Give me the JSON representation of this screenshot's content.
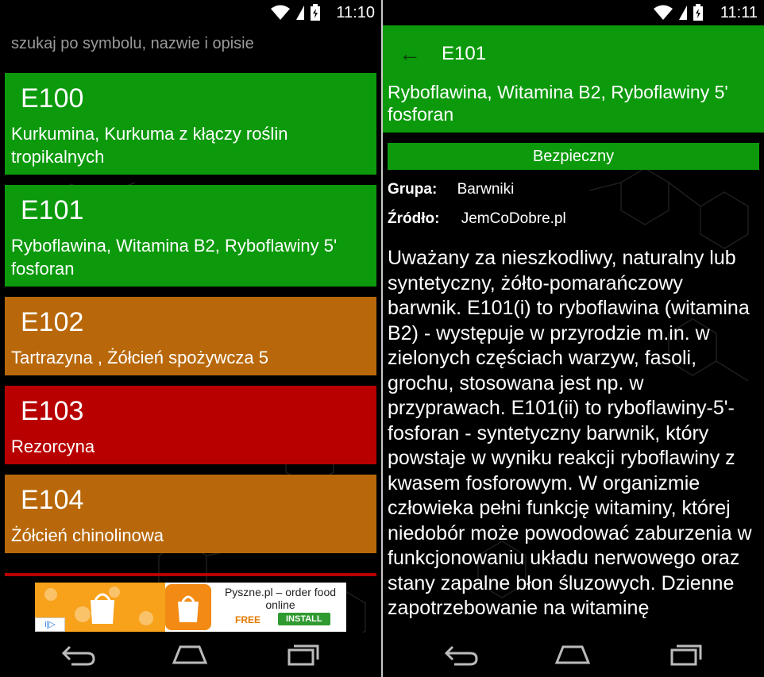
{
  "colors": {
    "green": "#0c9a0c",
    "orange": "#b8680a",
    "red": "#b80000",
    "background": "#000000"
  },
  "left": {
    "status": {
      "time": "11:10"
    },
    "search": {
      "placeholder": "szukaj po symbolu, nazwie i opisie"
    },
    "items": [
      {
        "code": "E100",
        "name": "Kurkumina, Kurkuma z kłączy roślin tropikalnych",
        "status": "green"
      },
      {
        "code": "E101",
        "name": "Ryboflawina, Witamina B2, Ryboflawiny 5' fosforan",
        "status": "green"
      },
      {
        "code": "E102",
        "name": "Tartrazyna , Żółcień spożywcza 5",
        "status": "orange"
      },
      {
        "code": "E103",
        "name": "Rezorcyna",
        "status": "red"
      },
      {
        "code": "E104",
        "name": "Żółcień chinolinowa",
        "status": "orange"
      }
    ],
    "ad": {
      "title": "Pyszne.pl – order food online",
      "price": "FREE",
      "install": "INSTALL",
      "choices_icon": "adchoices-icon"
    }
  },
  "right": {
    "status": {
      "time": "11:11"
    },
    "detail": {
      "code": "E101",
      "name": "Ryboflawina, Witamina B2, Ryboflawiny 5' fosforan",
      "safety": "Bezpieczny",
      "group_label": "Grupa:",
      "group_value": "Barwniki",
      "source_label": "Źródło:",
      "source_value": "JemCoDobre.pl",
      "description": "Uważany za nieszkodliwy, naturalny lub syntetyczny, żółto-pomarańczowy barwnik. E101(i) to ryboflawina (witamina B2) - występuje w przyrodzie m.in. w zielonych częściach warzyw, fasoli, grochu, stosowana jest np. w przyprawach. E101(ii) to ryboflawiny-5'-fosforan - syntetyczny barwnik, który powstaje w wyniku reakcji ryboflawiny z kwasem fosforowym. W organizmie człowieka pełni funkcję witaminy, której niedobór może powodować zaburzenia w funkcjonowaniu układu nerwowego oraz stany zapalne błon śluzowych. Dzienne zapotrzebowanie na witaminę"
    }
  },
  "navbar": {
    "icons": [
      "back-icon",
      "home-icon",
      "recents-icon"
    ]
  }
}
